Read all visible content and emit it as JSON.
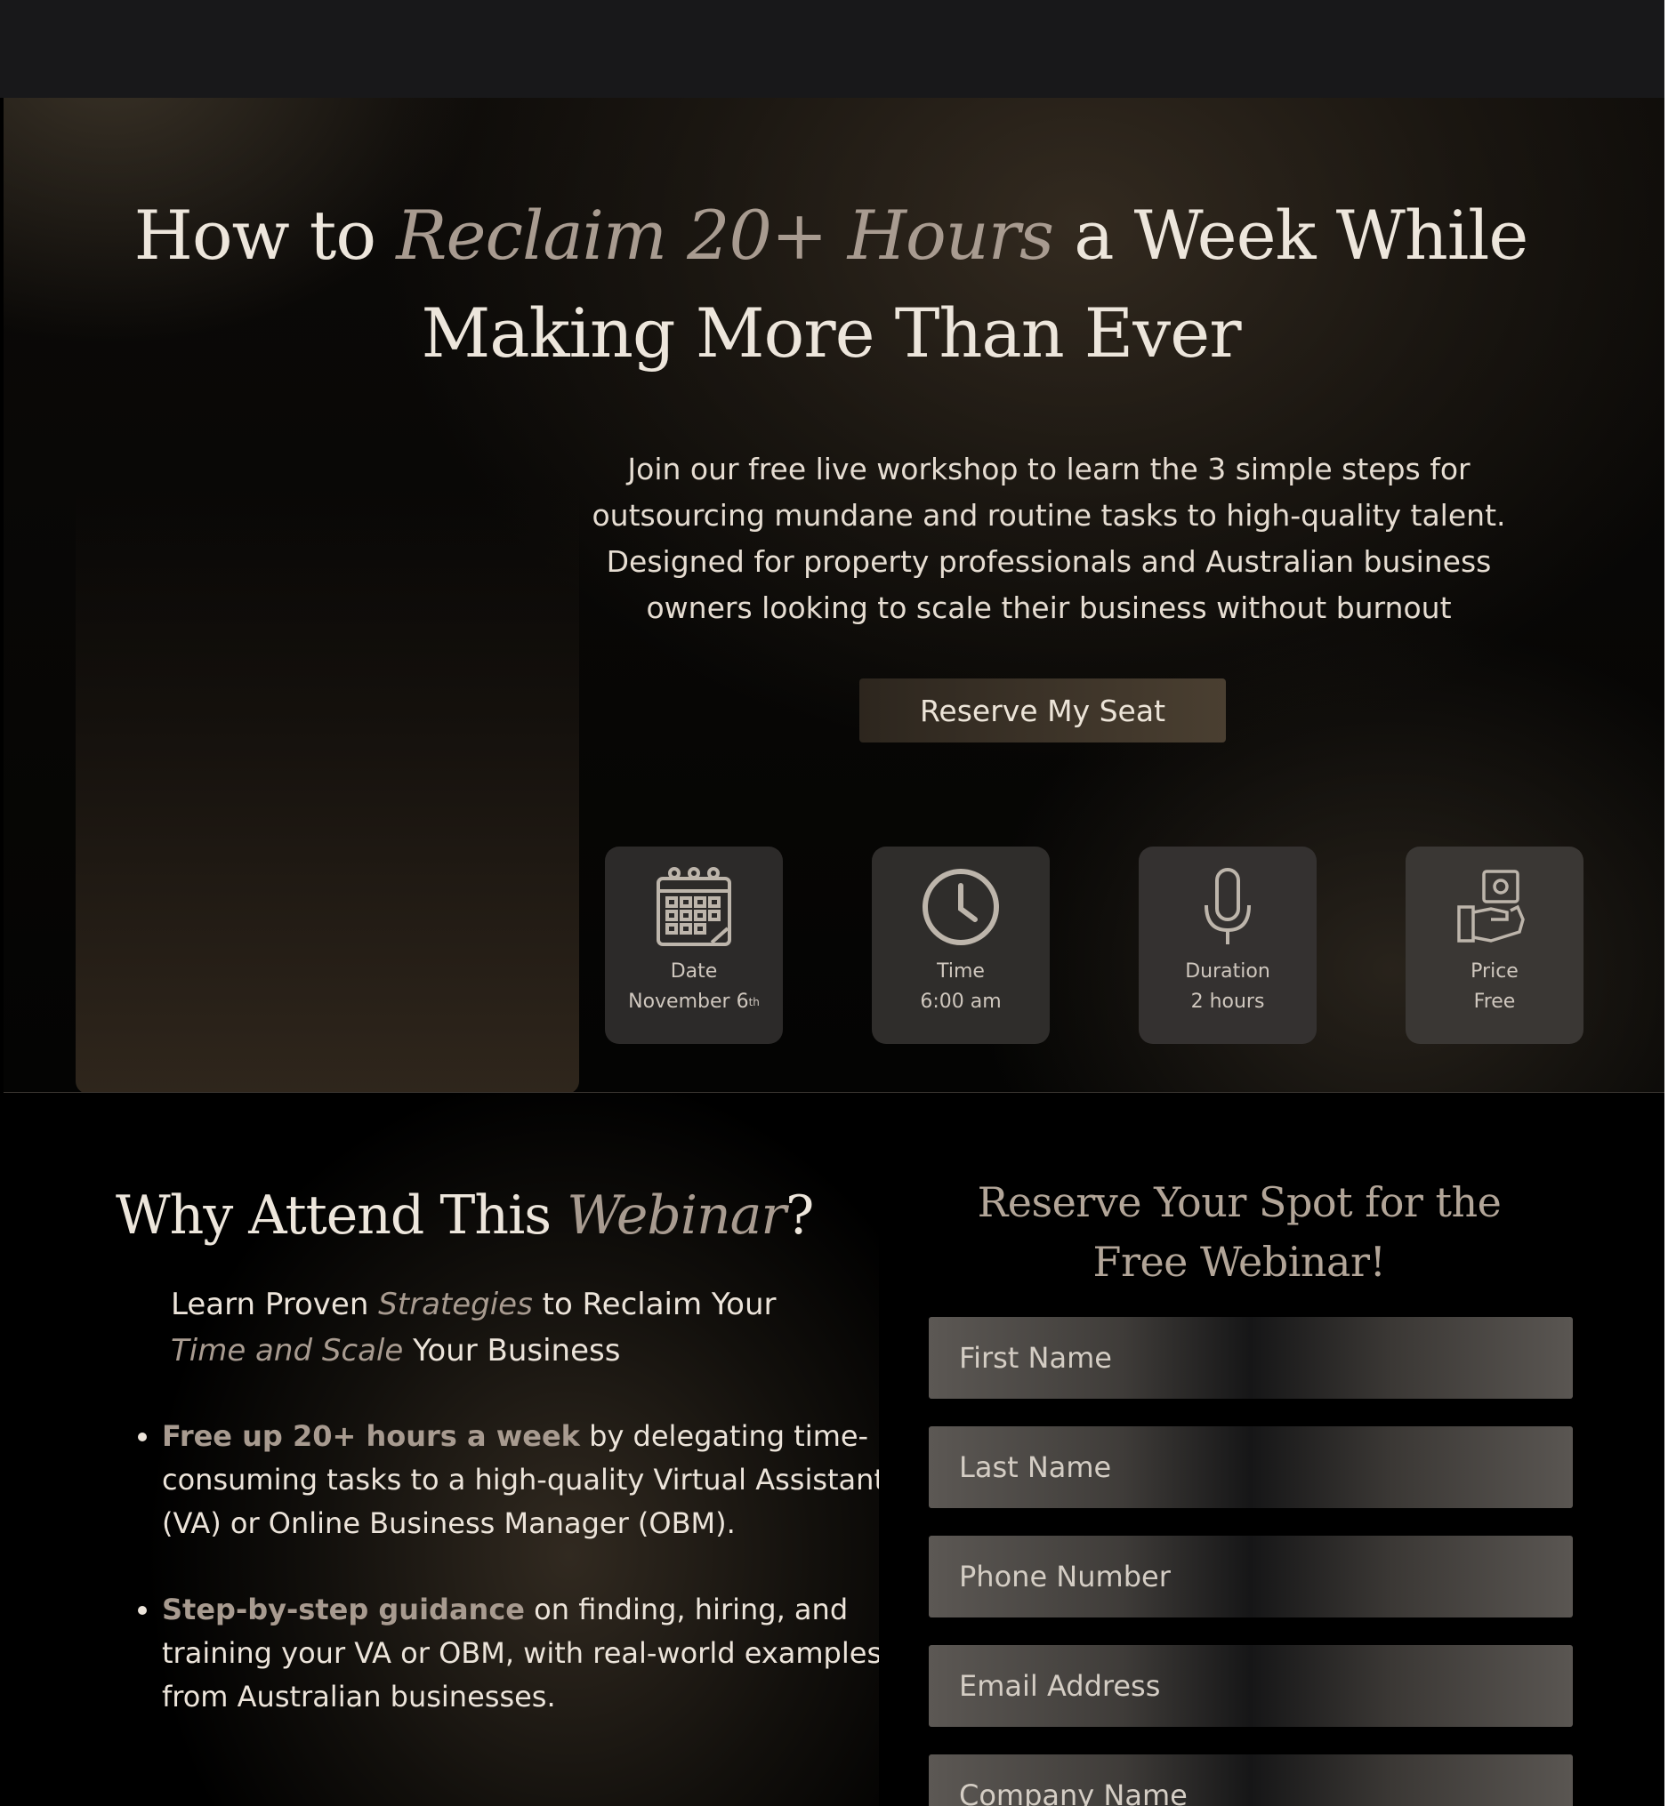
{
  "hero": {
    "title_part1": "How to ",
    "title_em": "Reclaim 20+ Hours",
    "title_part2": " a Week While Making More Than Ever",
    "subtitle": "Join our free live workshop to learn the 3 simple steps for outsourcing mundane and routine tasks to high-quality talent. Designed for property professionals and Australian business owners looking to scale their business without burnout",
    "cta_label": "Reserve My Seat"
  },
  "cards": [
    {
      "label": "Date",
      "value": "November 6",
      "suffix": "th",
      "icon": "calendar-icon"
    },
    {
      "label": "Time",
      "value": "6:00 am",
      "icon": "clock-icon"
    },
    {
      "label": "Duration",
      "value": "2 hours",
      "icon": "microphone-icon"
    },
    {
      "label": "Price",
      "value": "Free",
      "icon": "cash-hand-icon"
    }
  ],
  "why": {
    "title_part1": "Why Attend This ",
    "title_em": "Webinar",
    "title_part2": "?",
    "sub_part1": "Learn Proven ",
    "sub_em1": "Strategies",
    "sub_part2": " to Reclaim Your ",
    "sub_em2": "Time and Scale",
    "sub_part3": " Your Business",
    "bullets": [
      {
        "bold": "Free up 20+ hours a week",
        "rest": " by delegating time-consuming tasks to a high-quality Virtual Assistant (VA) or Online Business Manager (OBM)."
      },
      {
        "bold": "Step-by-step guidance",
        "rest": " on finding, hiring, and training your VA or OBM, with real-world examples from Australian businesses."
      }
    ]
  },
  "form": {
    "title": "Reserve Your Spot for the Free Webinar!",
    "fields": [
      {
        "placeholder": "First Name"
      },
      {
        "placeholder": "Last Name"
      },
      {
        "placeholder": "Phone Number"
      },
      {
        "placeholder": "Email Address"
      },
      {
        "placeholder": "Company Name"
      }
    ]
  },
  "colors": {
    "accent_muted": "#a89b90",
    "text_light": "#ede6dc",
    "button_gradient_start": "#2d261e",
    "button_gradient_end": "#4a3f31"
  }
}
